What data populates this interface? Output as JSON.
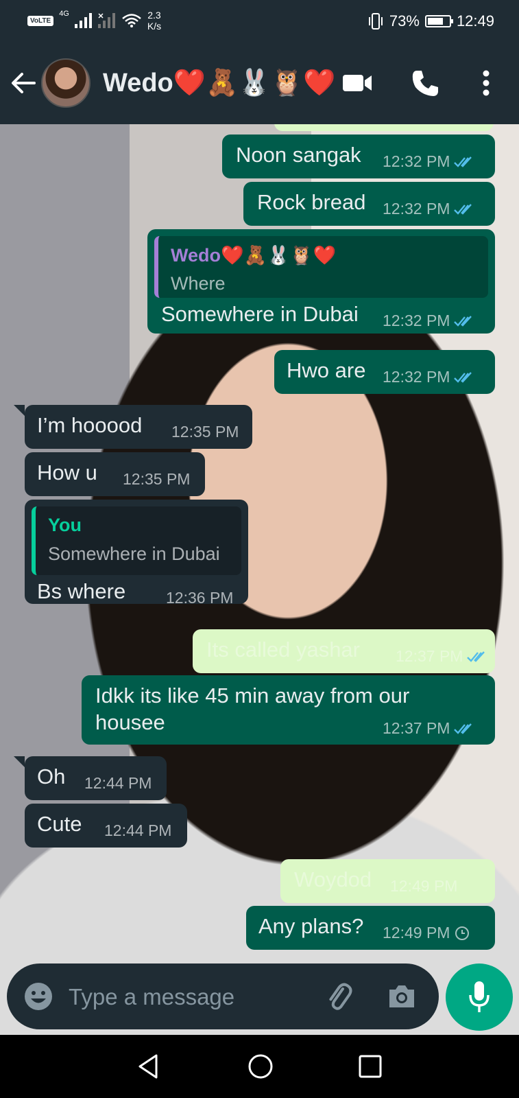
{
  "status_bar": {
    "volte": "VoLTE",
    "network": "4G",
    "speed_value": "2.3",
    "speed_unit": "K/s",
    "battery": "73%",
    "battery_level": 0.73,
    "time": "12:49"
  },
  "header": {
    "contact_name": "Wedo❤️🧸🐰🦉❤️"
  },
  "messages": [
    {
      "text": "Noon sangak",
      "time": "12:32 PM",
      "status": "read"
    },
    {
      "text": "Rock bread",
      "time": "12:32 PM",
      "status": "read"
    },
    {
      "quote_author": "Wedo❤️🧸🐰🦉❤️",
      "quote_text": "Where",
      "text": "Somewhere in Dubai",
      "time": "12:32 PM",
      "status": "read"
    },
    {
      "text": "Hwo are",
      "time": "12:32 PM",
      "status": "read"
    },
    {
      "text": "I’m hooood",
      "time": "12:35 PM"
    },
    {
      "text": "How u",
      "time": "12:35 PM"
    },
    {
      "quote_author": "You",
      "quote_text": "Somewhere in Dubai",
      "text": "Bs where",
      "time": "12:36 PM"
    },
    {
      "text": "Its called yashar",
      "time": "12:37 PM",
      "status": "read"
    },
    {
      "text": "Idkk its like 45 min away from our",
      "text2": "housee",
      "time": "12:37 PM",
      "status": "read"
    },
    {
      "text": "Oh",
      "time": "12:44 PM"
    },
    {
      "text": "Cute",
      "time": "12:44 PM"
    },
    {
      "text": "Woydod",
      "time": "12:49 PM"
    },
    {
      "text": "Any plans?",
      "time": "12:49 PM",
      "status": "pending"
    }
  ],
  "input": {
    "placeholder": "Type a message"
  },
  "colors": {
    "outgoing_bubble": "#005c4b",
    "incoming_bubble": "#1f2c34",
    "accent": "#00a884",
    "read_ticks": "#53bdeb"
  }
}
